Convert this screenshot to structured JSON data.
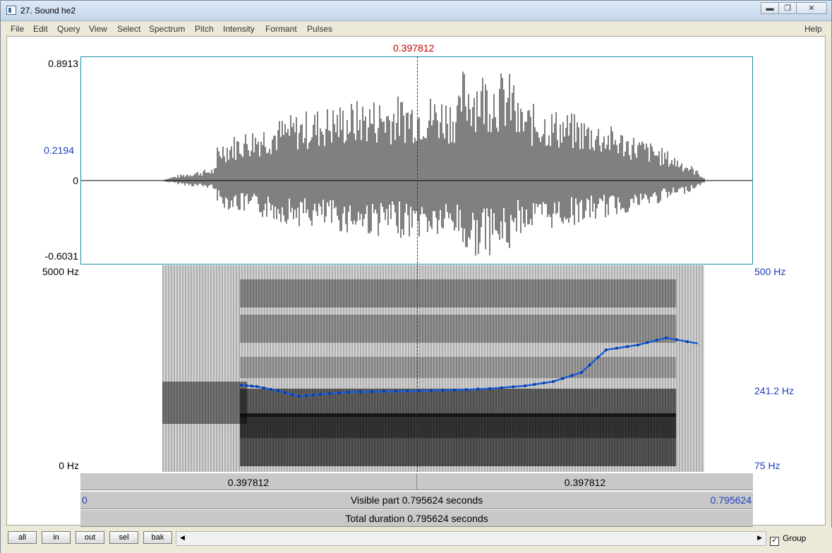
{
  "window": {
    "title": "27. Sound he2"
  },
  "menu": {
    "items": [
      "File",
      "Edit",
      "Query",
      "View",
      "Select",
      "Spectrum",
      "Pitch",
      "Intensity",
      "Formant",
      "Pulses"
    ],
    "help": "Help"
  },
  "cursor": {
    "time_label": "0.397812",
    "fraction": 0.5
  },
  "waveform": {
    "y_top": "0.8913",
    "y_mid": "0.2194",
    "y_zero": "0",
    "y_bottom": "-0.6031"
  },
  "spectrogram": {
    "f_top": "5000 Hz",
    "f_bottom": "0 Hz"
  },
  "pitch": {
    "p_top": "500 Hz",
    "p_mid": "241.2 Hz",
    "p_bottom": "75 Hz"
  },
  "timebar": {
    "left": "0.397812",
    "right": "0.397812"
  },
  "visible": {
    "start": "0",
    "label": "Visible part 0.795624 seconds",
    "end": "0.795624"
  },
  "total": {
    "label": "Total duration 0.795624 seconds"
  },
  "buttons": {
    "all": "all",
    "in": "in",
    "out": "out",
    "sel": "sel",
    "bak": "bak"
  },
  "group": {
    "label": "Group",
    "checked": true
  },
  "colors": {
    "cursor": "#c00000",
    "axis_blue": "#1a3fbf",
    "pitch_line": "#1a5fd6"
  }
}
